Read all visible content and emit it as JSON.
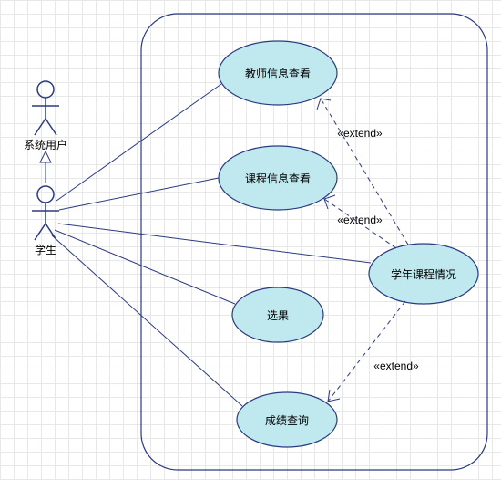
{
  "diagram": {
    "type": "uml-use-case",
    "actors": {
      "system_user": {
        "label": "系统用户"
      },
      "student": {
        "label": "学生"
      }
    },
    "generalization": {
      "child": "student",
      "parent": "system_user"
    },
    "usecases": {
      "uc1": {
        "label": "教师信息查看"
      },
      "uc2": {
        "label": "课程信息查看"
      },
      "uc3": {
        "label": "选果"
      },
      "uc4": {
        "label": "成绩查询"
      },
      "uc5": {
        "label": "学年课程情况"
      }
    },
    "stereotypes": {
      "extend1": "«extend»",
      "extend2": "«extend»",
      "extend3": "«extend»"
    },
    "associations": [
      {
        "from": "student",
        "to": "uc1"
      },
      {
        "from": "student",
        "to": "uc2"
      },
      {
        "from": "student",
        "to": "uc3"
      },
      {
        "from": "student",
        "to": "uc4"
      },
      {
        "from": "student",
        "to": "uc5"
      }
    ],
    "extends": [
      {
        "from": "uc5",
        "to": "uc1"
      },
      {
        "from": "uc5",
        "to": "uc2"
      },
      {
        "from": "uc5",
        "to": "uc4"
      }
    ]
  }
}
